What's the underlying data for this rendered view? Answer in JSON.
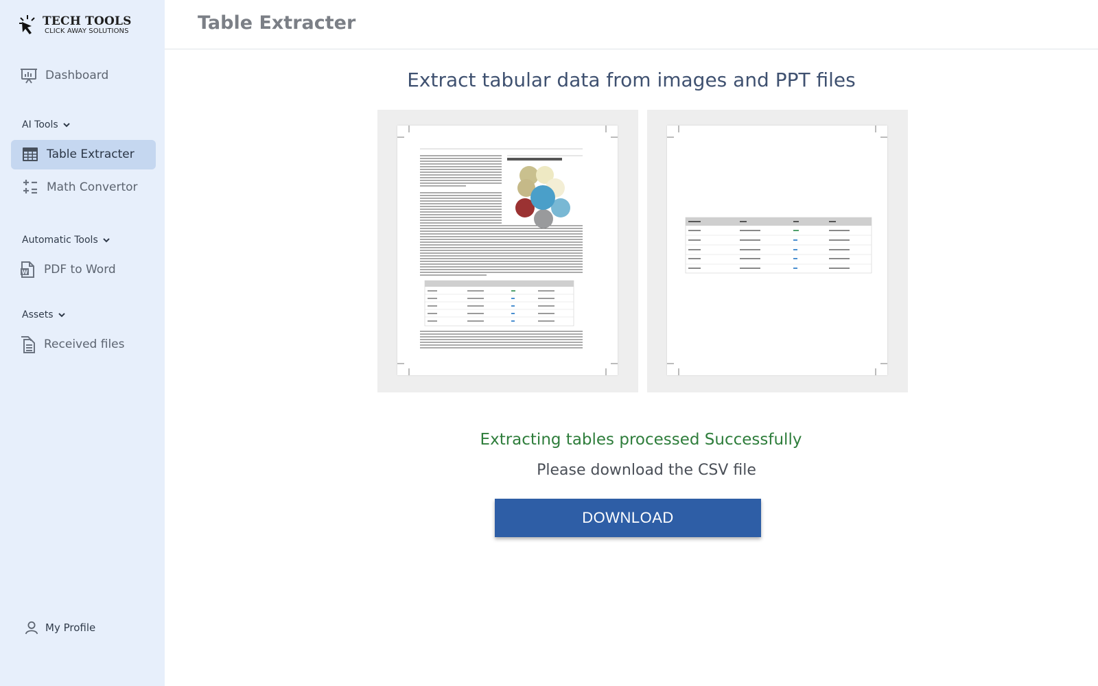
{
  "brand": {
    "title": "TECH TOOLS",
    "subtitle": "CLICK AWAY SOLUTIONS"
  },
  "sidebar": {
    "dashboard": {
      "label": "Dashboard",
      "icon": "presentation-chart-icon"
    },
    "sections": [
      {
        "title": "AI Tools",
        "items": [
          {
            "label": "Table Extracter",
            "icon": "table-icon",
            "active": true
          },
          {
            "label": "Math Convertor",
            "icon": "math-operators-icon"
          }
        ]
      },
      {
        "title": "Automatic Tools",
        "items": [
          {
            "label": "PDF to Word",
            "icon": "word-document-icon"
          }
        ]
      },
      {
        "title": "Assets",
        "items": [
          {
            "label": "Received files",
            "icon": "files-icon"
          }
        ]
      }
    ],
    "profile": {
      "label": "My Profile",
      "icon": "user-icon"
    }
  },
  "header": {
    "title": "Table Extracter"
  },
  "main": {
    "headline": "Extract tabular data from images and PPT files",
    "status_success": "Extracting tables processed Successfully",
    "status_note": "Please download the CSV file",
    "download_label": "DOWNLOAD"
  },
  "colors": {
    "sidebar_bg": "#e7effb",
    "active_bg": "#c5d7f0",
    "success": "#2e7d3b",
    "button": "#2e5ea6"
  }
}
